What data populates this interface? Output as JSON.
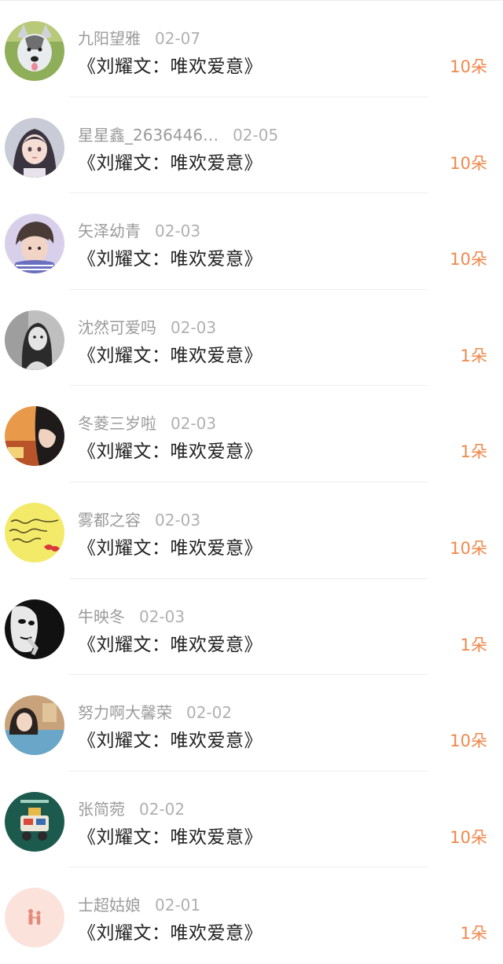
{
  "records": [
    {
      "name": "九阳望雅",
      "date": "02-07",
      "title": "《刘耀文：唯欢爱意》",
      "amount": "10朵",
      "avatar": "husky-dog-avatar"
    },
    {
      "name": "星星鑫_2636446…",
      "date": "02-05",
      "title": "《刘耀文：唯欢爱意》",
      "amount": "10朵",
      "avatar": "anime-girl-avatar"
    },
    {
      "name": "矢泽幼青",
      "date": "02-03",
      "title": "《刘耀文：唯欢爱意》",
      "amount": "10朵",
      "avatar": "boy-portrait-avatar"
    },
    {
      "name": "沈然可爱吗",
      "date": "02-03",
      "title": "《刘耀文：唯欢爱意》",
      "amount": "1朵",
      "avatar": "bw-girl-avatar"
    },
    {
      "name": "冬菱三岁啦",
      "date": "02-03",
      "title": "《刘耀文：唯欢爱意》",
      "amount": "1朵",
      "avatar": "girl-sunset-avatar"
    },
    {
      "name": "雾都之容",
      "date": "02-03",
      "title": "《刘耀文：唯欢爱意》",
      "amount": "10朵",
      "avatar": "yellow-handwriting-avatar"
    },
    {
      "name": "牛映冬",
      "date": "02-03",
      "title": "《刘耀文：唯欢爱意》",
      "amount": "1朵",
      "avatar": "dark-mask-avatar"
    },
    {
      "name": "努力啊大馨荣",
      "date": "02-02",
      "title": "《刘耀文：唯欢爱意》",
      "amount": "10朵",
      "avatar": "girl-pool-avatar"
    },
    {
      "name": "张简菀",
      "date": "02-02",
      "title": "《刘耀文：唯欢爱意》",
      "amount": "10朵",
      "avatar": "green-cartoon-avatar"
    },
    {
      "name": "士超姑娘",
      "date": "02-01",
      "title": "《刘耀文：唯欢爱意》",
      "amount": "1朵",
      "avatar": "pink-couple-avatar"
    }
  ],
  "colors": {
    "accent": "#f0874a",
    "name_text": "#9b9b9b",
    "title_text": "#222222"
  }
}
